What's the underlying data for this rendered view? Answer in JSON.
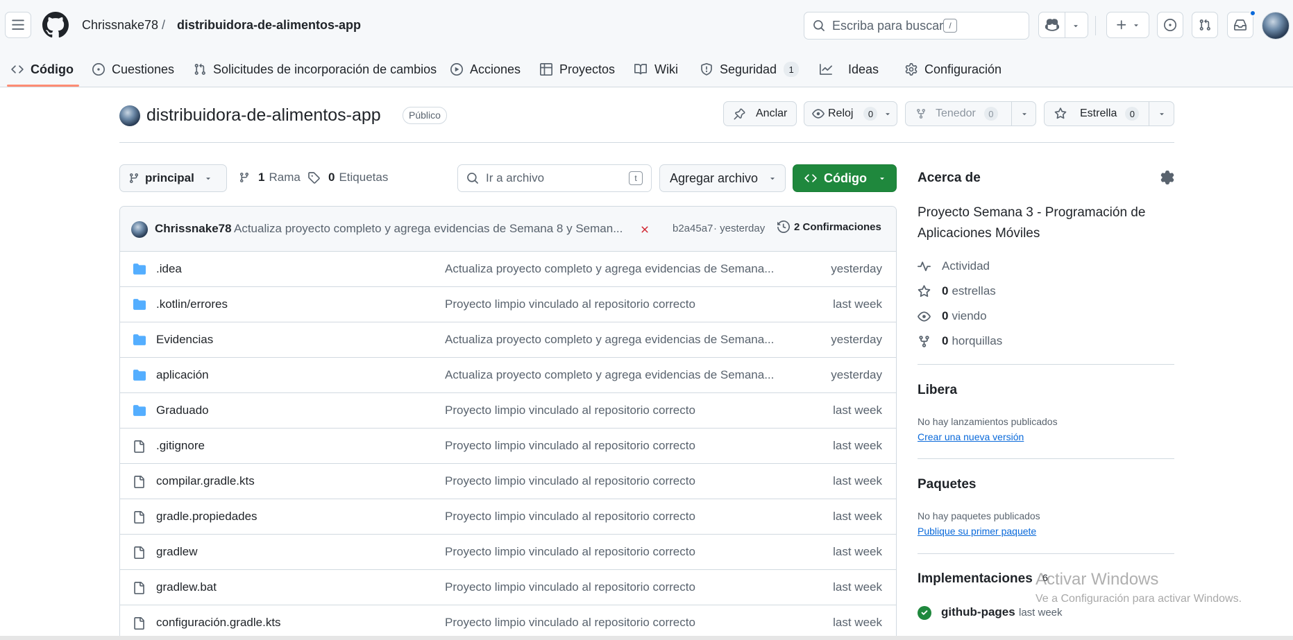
{
  "header": {
    "owner": "Chrissnake78",
    "separator": "/",
    "repo": "distribuidora-de-alimentos-app",
    "search_placeholder": "Escriba para buscar",
    "search_key": "/"
  },
  "tabs": [
    {
      "label": "Código",
      "icon": "code-icon"
    },
    {
      "label": "Cuestiones",
      "icon": "issue-icon"
    },
    {
      "label": "Solicitudes de incorporación de cambios",
      "icon": "pull-request-icon"
    },
    {
      "label": "Acciones",
      "icon": "play-icon"
    },
    {
      "label": "Proyectos",
      "icon": "table-icon"
    },
    {
      "label": "Wiki",
      "icon": "book-icon"
    },
    {
      "label": "Seguridad",
      "icon": "shield-icon",
      "count": "1"
    },
    {
      "label": "Ideas",
      "icon": "graph-icon"
    },
    {
      "label": "Configuración",
      "icon": "gear-icon"
    }
  ],
  "repo_header": {
    "name": "distribuidora-de-alimentos-app",
    "visibility": "Público",
    "pin_label": "Anclar",
    "watch_label": "Reloj",
    "watch_count": "0",
    "fork_label": "Tenedor",
    "fork_count": "0",
    "star_label": "Estrella",
    "star_count": "0"
  },
  "toolbar": {
    "branch": "principal",
    "branches_count": "1",
    "branches_label": "Rama",
    "tags_count": "0",
    "tags_label": "Etiquetas",
    "goto_placeholder": "Ir a archivo",
    "goto_key": "t",
    "add_file": "Agregar archivo",
    "code_button": "Código"
  },
  "commit": {
    "author": "Chrissnake78",
    "message": "Actualiza proyecto completo y agrega evidencias de Semana 8 y Seman...",
    "hash": "b2a45a7",
    "time": "· yesterday",
    "commits_label": "2 Confirmaciones",
    "status_color": "#d1242f"
  },
  "files": [
    {
      "name": ".idea",
      "type": "folder",
      "message": "Actualiza proyecto completo y agrega evidencias de Semana...",
      "age": "yesterday"
    },
    {
      "name": ".kotlin/errores",
      "type": "folder",
      "message": "Proyecto limpio vinculado al repositorio correcto",
      "age": "last week"
    },
    {
      "name": "Evidencias",
      "type": "folder",
      "message": "Actualiza proyecto completo y agrega evidencias de Semana...",
      "age": "yesterday"
    },
    {
      "name": "aplicación",
      "type": "folder",
      "message": "Actualiza proyecto completo y agrega evidencias de Semana...",
      "age": "yesterday"
    },
    {
      "name": "Graduado",
      "type": "folder",
      "message": "Proyecto limpio vinculado al repositorio correcto",
      "age": "last week"
    },
    {
      "name": ".gitignore",
      "type": "file",
      "message": "Proyecto limpio vinculado al repositorio correcto",
      "age": "last week"
    },
    {
      "name": "compilar.gradle.kts",
      "type": "file",
      "message": "Proyecto limpio vinculado al repositorio correcto",
      "age": "last week"
    },
    {
      "name": "gradle.propiedades",
      "type": "file",
      "message": "Proyecto limpio vinculado al repositorio correcto",
      "age": "last week"
    },
    {
      "name": "gradlew",
      "type": "file",
      "message": "Proyecto limpio vinculado al repositorio correcto",
      "age": "last week"
    },
    {
      "name": "gradlew.bat",
      "type": "file",
      "message": "Proyecto limpio vinculado al repositorio correcto",
      "age": "last week"
    },
    {
      "name": "configuración.gradle.kts",
      "type": "file",
      "message": "Proyecto limpio vinculado al repositorio correcto",
      "age": "last week"
    }
  ],
  "sidebar": {
    "about_title": "Acerca de",
    "description_line1": "Proyecto Semana 3 - Programación de",
    "description_line2": "Aplicaciones Móviles",
    "activity": "Actividad",
    "stars_count": "0",
    "stars_label": "estrellas",
    "watching_count": "0",
    "watching_label": "viendo",
    "forks_count": "0",
    "forks_label": "horquillas",
    "releases_title": "Libera",
    "releases_none": "No hay lanzamientos publicados",
    "releases_link": "Crear una nueva versión",
    "packages_title": "Paquetes",
    "packages_none": "No hay paquetes publicados",
    "packages_link": "Publique su primer paquete",
    "deployments_title": "Implementaciones",
    "deployments_count": "6",
    "deployment_name": "github-pages",
    "deployment_time": "last week"
  },
  "watermark": {
    "line1": "Activar Windows",
    "line2": "Ve a Configuración para activar Windows."
  },
  "colors": {
    "accent_green": "#1f883d",
    "folder_blue": "#54aeff",
    "link_blue": "#0969da",
    "tab_underline": "#fd8c73",
    "notification_dot": "#0969da"
  }
}
